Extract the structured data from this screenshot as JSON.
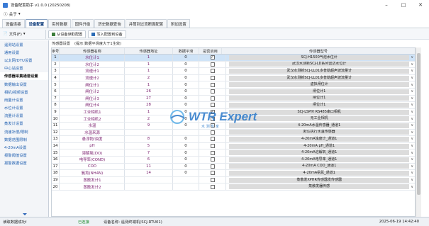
{
  "window": {
    "title": "设备配置助手 v1.0.0 (20250208)",
    "controls": [
      "minimize-icon",
      "maximize-icon",
      "close-icon"
    ]
  },
  "menubar": {
    "about": "关于",
    "about_arrow": "▾"
  },
  "tabs": [
    {
      "label": "设备连接",
      "active": false
    },
    {
      "label": "设备配置",
      "active": true
    },
    {
      "label": "实时数据",
      "active": false
    },
    {
      "label": "固件升级",
      "active": false
    },
    {
      "label": "历史数据查询",
      "active": false
    },
    {
      "label": "井筒到过流断面配置",
      "active": false
    },
    {
      "label": "附加设置",
      "active": false
    }
  ],
  "toolbar": {
    "file_menu": "文件(F)",
    "read_config": "从设备读取配置",
    "write_config": "写入配置到设备"
  },
  "sidebar": {
    "items": [
      {
        "label": "遥测站设置",
        "active": false
      },
      {
        "label": "通用设置",
        "active": false
      },
      {
        "label": "以太网/DTU设置",
        "active": false
      },
      {
        "label": "中心站设置",
        "active": false
      },
      {
        "label": "传感器采集通道设置",
        "active": true
      },
      {
        "label": "数据输出设置",
        "active": false
      },
      {
        "label": "相机/视频设置",
        "active": false
      },
      {
        "label": "雨量计设置",
        "active": false
      },
      {
        "label": "水位计设置",
        "active": false
      },
      {
        "label": "流量计设置",
        "active": false
      },
      {
        "label": "蒸发计设置",
        "active": false
      },
      {
        "label": "流速补偿/限制",
        "active": false
      },
      {
        "label": "数据范围限制",
        "active": false
      },
      {
        "label": "4-20mA设置",
        "active": false
      },
      {
        "label": "报警阈值设置",
        "active": false
      },
      {
        "label": "报警数据设置",
        "active": false
      }
    ]
  },
  "content": {
    "header": "传感器设置",
    "hint": "(提示:数据平滑度大于1生效)"
  },
  "table": {
    "columns": [
      "序号",
      "传感器名称",
      "传感器地址",
      "数据平滑",
      "是否启用",
      "传感器型号"
    ],
    "rows": [
      {
        "idx": "1",
        "name": "水位计1",
        "addr": "1",
        "coef": "0",
        "enabled": true,
        "model": "SCJ-H1500气泡水位计",
        "selected": true
      },
      {
        "idx": "2",
        "name": "水位计2",
        "addr": "1",
        "coef": "0",
        "enabled": false,
        "model": "武汉水测新SCJ-LD系列雷达水位计",
        "selected": false
      },
      {
        "idx": "3",
        "name": "流速计1",
        "addr": "1",
        "coef": "0",
        "enabled": false,
        "model": "武汉水测新SCJ-LL01多普勒超声波流量计",
        "selected": false
      },
      {
        "idx": "4",
        "name": "流速计2",
        "addr": "2",
        "coef": "0",
        "enabled": false,
        "model": "武汉水测新SCJ-LL01多普勒超声波流量计",
        "selected": false
      },
      {
        "idx": "5",
        "name": "闸位计1",
        "addr": "1",
        "coef": "0",
        "enabled": false,
        "model": "虚拟闸位计",
        "selected": false
      },
      {
        "idx": "6",
        "name": "闸位计2",
        "addr": "26",
        "coef": "0",
        "enabled": false,
        "model": "闸位计1",
        "selected": false
      },
      {
        "idx": "7",
        "name": "闸位计3",
        "addr": "27",
        "coef": "0",
        "enabled": false,
        "model": "闸位计1",
        "selected": false
      },
      {
        "idx": "8",
        "name": "闸位计4",
        "addr": "28",
        "coef": "0",
        "enabled": false,
        "model": "闸位计1",
        "selected": false
      },
      {
        "idx": "9",
        "name": "工业相机1",
        "addr": "1",
        "coef": "0",
        "enabled": true,
        "model": "SCJ-LSPIV RS485串口相机",
        "selected": false
      },
      {
        "idx": "10",
        "name": "工业相机2",
        "addr": "2",
        "coef": "0",
        "enabled": false,
        "model": "无工业相机",
        "selected": false
      },
      {
        "idx": "11",
        "name": "水温",
        "addr": "9",
        "coef": "0",
        "enabled": false,
        "model": "4-20mA水温传感器_通道1",
        "selected": false
      },
      {
        "idx": "12",
        "name": "水温来源",
        "addr": "",
        "coef": "",
        "enabled": false,
        "model": "默认执行水温传感器",
        "selected": false
      },
      {
        "idx": "13",
        "name": "悬浮物/浊度",
        "addr": "8",
        "coef": "0",
        "enabled": false,
        "model": "4-20mA浊度计_通道1",
        "selected": false
      },
      {
        "idx": "14",
        "name": "pH",
        "addr": "5",
        "coef": "0",
        "enabled": false,
        "model": "4-20mA pH_通道1",
        "selected": false
      },
      {
        "idx": "15",
        "name": "溶解氧(DO)",
        "addr": "7",
        "coef": "0",
        "enabled": false,
        "model": "4-20mA溶解氧_通道1",
        "selected": false
      },
      {
        "idx": "16",
        "name": "电导率(COND)",
        "addr": "6",
        "coef": "0",
        "enabled": false,
        "model": "4-20mA电导率_通道1",
        "selected": false
      },
      {
        "idx": "17",
        "name": "COD",
        "addr": "11",
        "coef": "0",
        "enabled": false,
        "model": "4-20mA COD_通道1",
        "selected": false
      },
      {
        "idx": "18",
        "name": "氨氮(NH4N)",
        "addr": "14",
        "coef": "0",
        "enabled": false,
        "model": "4-20mA氨氮_通道1",
        "selected": false
      },
      {
        "idx": "19",
        "name": "蒸散发计1",
        "addr": "",
        "coef": "",
        "enabled": false,
        "model": "蒸散发XPHR传感器发传感器",
        "selected": false
      },
      {
        "idx": "20",
        "name": "蒸散发计2",
        "addr": "",
        "coef": "",
        "enabled": false,
        "model": "蒸散发器传感",
        "selected": false
      }
    ]
  },
  "statusbar": {
    "left": "读取数据成功!",
    "conn_label": "已连接",
    "device_label": "设备名称:",
    "device_name": "遥测终端机(SCJ-RTU01)",
    "time": "2025-06-19 14:42:40"
  },
  "watermark": {
    "logo_text": "WTR Expert",
    "subtitle": "水 测 专 家"
  },
  "colors": {
    "accent": "#1f5fb0",
    "sensor_name": "#7a1f6e",
    "connected": "#1a8a2a",
    "selected_row": "#cfe3f7",
    "watermark_blue": "#2b79c9"
  }
}
